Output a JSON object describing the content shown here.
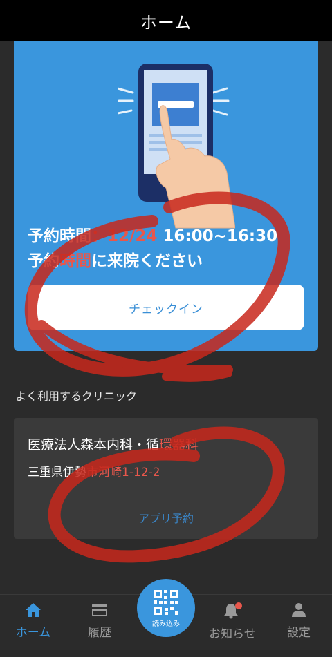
{
  "header": {
    "title": "ホーム"
  },
  "reservation": {
    "label": "予約時間",
    "separator": "：",
    "datetime": "12/24 16:00~16:30",
    "line2_pre": "予約",
    "line2_mid": "時間",
    "line2_post": "に来院ください",
    "checkin_label": "チェックイン"
  },
  "clinics": {
    "section_label": "よく利用するクリニック",
    "name_pre": "医療法人森本内科・循",
    "name_accent": "環器科",
    "address_pre": "三重県伊勢",
    "address_accent": "市河崎1-12-2",
    "reserve_label": "アプリ予約"
  },
  "tabbar": {
    "home": "ホーム",
    "history": "履歴",
    "scan": "読み込み",
    "notifications": "お知らせ",
    "settings": "設定"
  },
  "colors": {
    "accent_blue": "#3a96dd",
    "accent_red": "#e8574c",
    "background": "#2b2b2b"
  }
}
